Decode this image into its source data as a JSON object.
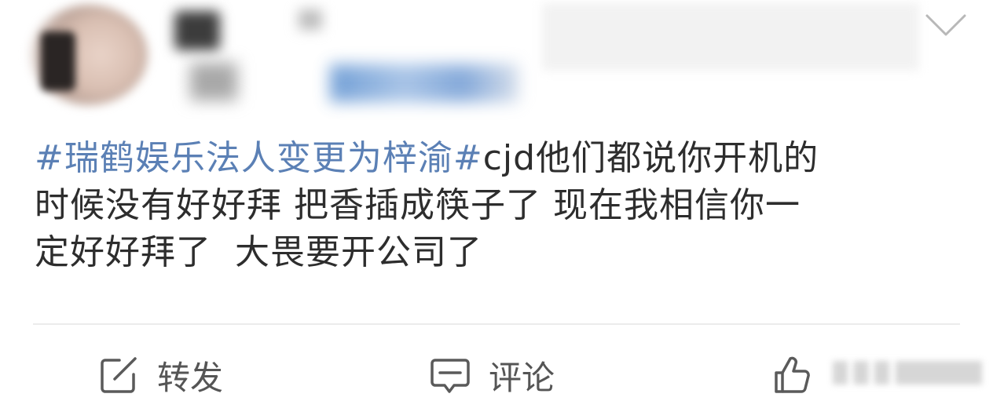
{
  "post": {
    "hashtag": "#瑞鹤娱乐法人变更为梓渝#",
    "text_line1_rest": "cjd他们都说你开机的",
    "text_line2": "时候没有好好拜 把香插成筷子了 现在我相信你一",
    "text_line3": "定好好拜了  大畏要开公司了"
  },
  "actions": {
    "repost_label": "转发",
    "comment_label": "评论",
    "like_label": ""
  },
  "colors": {
    "hashtag": "#5b80b5",
    "text": "#2d2d2d",
    "action_text": "#555555",
    "divider": "#ececec"
  },
  "icons": {
    "repost": "edit-square-icon",
    "comment": "comment-bubble-icon",
    "like": "thumbs-up-icon",
    "more": "chevron-down-icon"
  }
}
